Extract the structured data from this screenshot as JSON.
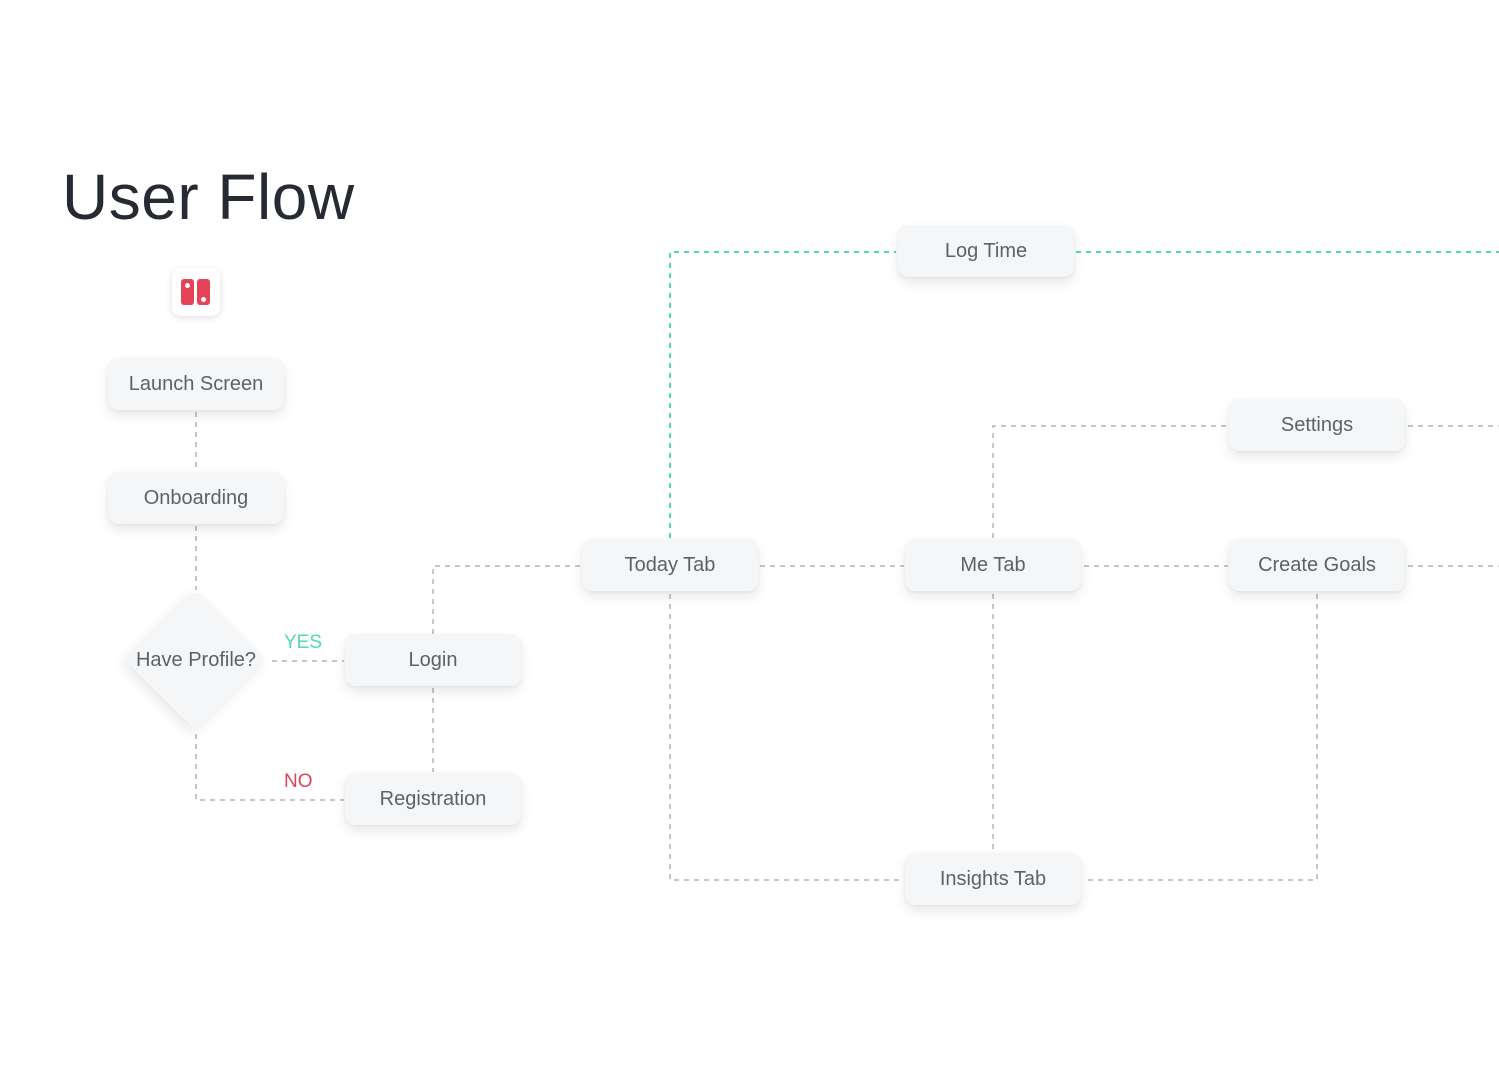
{
  "title": "User Flow",
  "app_icon": {
    "icon": "app-logo-icon",
    "color": "#e54458"
  },
  "nodes": {
    "launch_screen": "Launch Screen",
    "onboarding": "Onboarding",
    "have_profile": "Have Profile?",
    "login": "Login",
    "registration": "Registration",
    "today_tab": "Today Tab",
    "log_time": "Log Time",
    "me_tab": "Me Tab",
    "settings": "Settings",
    "create_goals": "Create Goals",
    "insights_tab": "Insights Tab"
  },
  "branches": {
    "yes": {
      "label": "YES",
      "color": "#4fd8b8"
    },
    "no": {
      "label": "NO",
      "color": "#d9445a"
    }
  },
  "connectors": {
    "default_color": "#c4c6c9",
    "highlight_color": "#4fd8b8"
  },
  "edges": [
    {
      "from": "launch_screen",
      "to": "onboarding",
      "style": "default"
    },
    {
      "from": "onboarding",
      "to": "have_profile",
      "style": "default"
    },
    {
      "from": "have_profile",
      "to": "login",
      "style": "default",
      "label": "YES"
    },
    {
      "from": "have_profile",
      "to": "registration",
      "style": "default",
      "label": "NO"
    },
    {
      "from": "registration",
      "to": "login",
      "style": "default"
    },
    {
      "from": "login",
      "to": "today_tab",
      "style": "default"
    },
    {
      "from": "today_tab",
      "to": "log_time",
      "style": "highlight"
    },
    {
      "from": "log_time",
      "to": "offscreen-right",
      "style": "highlight"
    },
    {
      "from": "today_tab",
      "to": "me_tab",
      "style": "default"
    },
    {
      "from": "today_tab",
      "to": "insights_tab",
      "style": "default"
    },
    {
      "from": "me_tab",
      "to": "settings",
      "style": "default"
    },
    {
      "from": "me_tab",
      "to": "create_goals",
      "style": "default"
    },
    {
      "from": "me_tab",
      "to": "insights_tab",
      "style": "default"
    },
    {
      "from": "create_goals",
      "to": "insights_tab",
      "style": "default"
    },
    {
      "from": "settings",
      "to": "offscreen-right",
      "style": "default"
    },
    {
      "from": "create_goals",
      "to": "offscreen-right",
      "style": "default"
    }
  ]
}
